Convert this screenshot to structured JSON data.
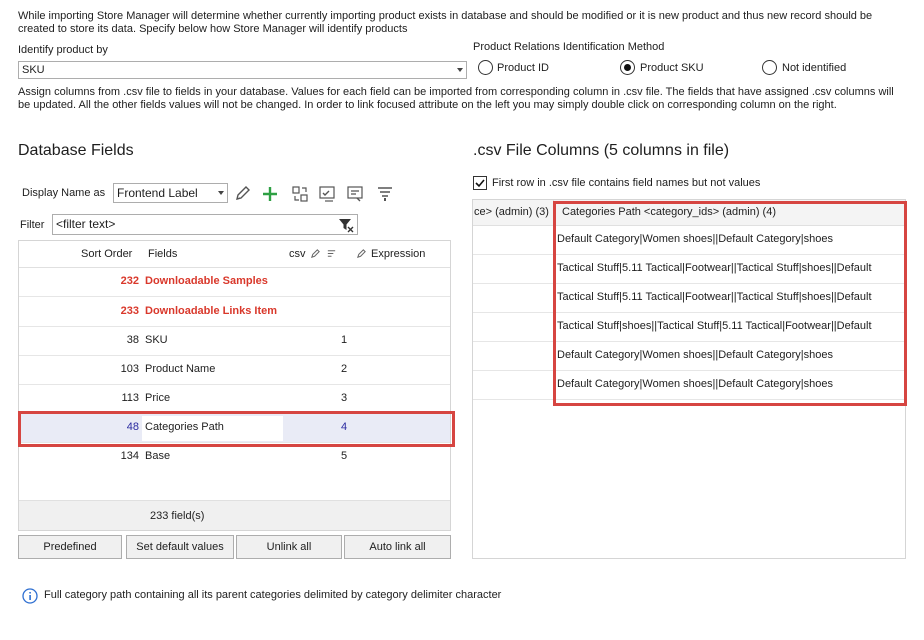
{
  "intro_text": "While importing Store Manager will determine whether currently importing product exists in database and should be modified or it is new product and thus new record should be created to store its data. Specify below how Store Manager will identify products",
  "identify": {
    "label": "Identify product by",
    "value": "SKU"
  },
  "relations": {
    "label": "Product Relations Identification Method",
    "options": [
      {
        "label": "Product ID",
        "selected": false
      },
      {
        "label": "Product SKU",
        "selected": true
      },
      {
        "label": "Not identified",
        "selected": false
      }
    ]
  },
  "assign_text": "Assign columns from .csv file to fields in your database. Values for each field can be imported from corresponding column in .csv file. The fields that have assigned .csv columns will be updated. All the other fields values will not be changed. In order to link focused attribute on the left you may simply double click on corresponding column on the right.",
  "db": {
    "title": "Database Fields",
    "display_name_label": "Display Name as",
    "display_name_value": "Frontend Label",
    "filter_label": "Filter",
    "filter_placeholder": "<filter text>",
    "headers": {
      "sort": "Sort Order",
      "fields": "Fields",
      "csv": "csv",
      "expression": "Expression"
    },
    "rows": [
      {
        "sort": "232",
        "field": "Downloadable Samples",
        "csv": ""
      },
      {
        "sort": "233",
        "field": "Downloadable Links Item",
        "csv": ""
      },
      {
        "sort": "38",
        "field": "SKU",
        "csv": "1"
      },
      {
        "sort": "103",
        "field": "Product Name",
        "csv": "2"
      },
      {
        "sort": "113",
        "field": "Price",
        "csv": "3"
      },
      {
        "sort": "48",
        "field": "Categories Path",
        "csv": "4"
      },
      {
        "sort": "134",
        "field": "Base",
        "csv": "5"
      }
    ],
    "footer": "233 field(s)"
  },
  "buttons": {
    "predefined": "Predefined",
    "set_default": "Set default values",
    "unlink_all": "Unlink all",
    "auto_link_all": "Auto link all"
  },
  "csv": {
    "title": ".csv File Columns (5 columns in file)",
    "first_row_label": "First row in .csv file contains field names but not values",
    "col_prev_header": "ce> (admin) (3)",
    "col_header": "Categories Path <category_ids> (admin) (4)",
    "values": [
      "Default Category|Women shoes||Default Category|shoes",
      "Tactical Stuff|5.11 Tactical|Footwear||Tactical Stuff|shoes||Default",
      "Tactical Stuff|5.11 Tactical|Footwear||Tactical Stuff|shoes||Default",
      "Tactical Stuff|shoes||Tactical Stuff|5.11 Tactical|Footwear||Default",
      "Default Category|Women shoes||Default Category|shoes",
      "Default Category|Women shoes||Default Category|shoes"
    ]
  },
  "info_text": "Full category path containing all its parent categories delimited by category delimiter character",
  "colors": {
    "accent_red": "#d9382b",
    "highlight_border": "#d64541",
    "link_blue": "#2a2aa0"
  }
}
